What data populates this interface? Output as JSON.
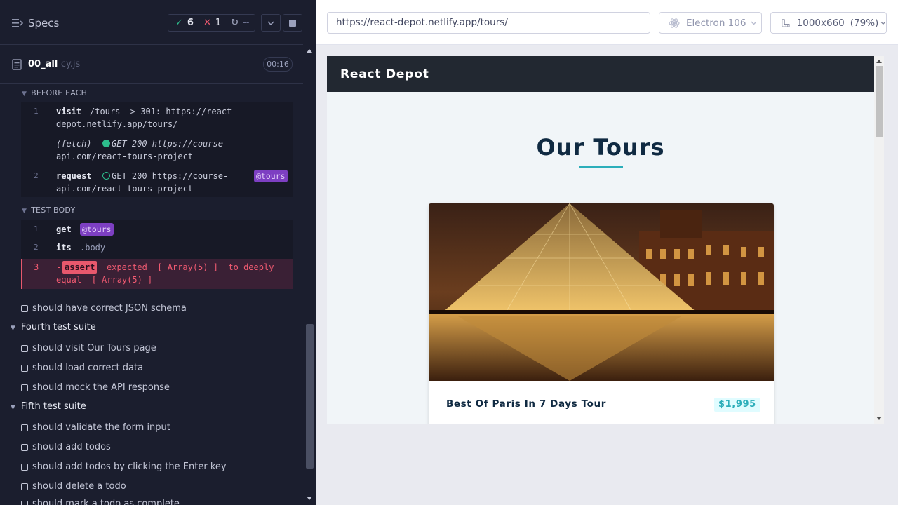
{
  "header": {
    "specs_label": "Specs",
    "passed": "6",
    "failed": "1",
    "pending": "--"
  },
  "spec": {
    "name": "00_all",
    "ext": "cy.js",
    "duration": "00:16"
  },
  "before_each": {
    "title": "BEFORE EACH",
    "commands": [
      {
        "num": "1",
        "name": "visit",
        "msg_line1": "/tours -> 301: https://react-",
        "msg_line2": "depot.netlify.app/tours/"
      },
      {
        "num": "",
        "name": "(fetch)",
        "status": "GET 200 https://course-",
        "msg_line2": "api.com/react-tours-project"
      },
      {
        "num": "2",
        "name": "request",
        "status": "GET 200 https://course-",
        "msg_line2": "api.com/react-tours-project",
        "alias": "@tours"
      }
    ]
  },
  "test_body": {
    "title": "TEST BODY",
    "commands": [
      {
        "num": "1",
        "name": "get",
        "alias": "@tours"
      },
      {
        "num": "2",
        "name": "its",
        "msg": ".body"
      },
      {
        "num": "3",
        "dash": "-",
        "name": "assert",
        "msg_line1": "expected  [ Array(5) ]  to deeply",
        "msg_line2": "equal  [ Array(5) ]"
      }
    ]
  },
  "tests": [
    {
      "type": "test",
      "label": "should have correct JSON schema"
    },
    {
      "type": "suite",
      "label": "Fourth test suite"
    },
    {
      "type": "test",
      "label": "should visit Our Tours page"
    },
    {
      "type": "test",
      "label": "should load correct data"
    },
    {
      "type": "test",
      "label": "should mock the API response"
    },
    {
      "type": "suite",
      "label": "Fifth test suite"
    },
    {
      "type": "test",
      "label": "should validate the form input"
    },
    {
      "type": "test",
      "label": "should add todos"
    },
    {
      "type": "test",
      "label": "should add todos by clicking the Enter key"
    },
    {
      "type": "test",
      "label": "should delete a todo"
    },
    {
      "type": "test",
      "label": "should mark a todo as complete"
    }
  ],
  "topbar": {
    "url": "https://react-depot.netlify.app/tours/",
    "browser": "Electron 106",
    "viewport": "1000x660",
    "zoom": "(79%)"
  },
  "aut": {
    "brand": "React Depot",
    "page_title": "Our Tours",
    "tour": {
      "name": "Best Of Paris In 7 Days Tour",
      "price": "$1,995"
    }
  },
  "colors": {
    "pass": "#2dbd8c",
    "fail": "#f05a71",
    "alias": "#7d3fc2",
    "accent": "#2caeba"
  }
}
